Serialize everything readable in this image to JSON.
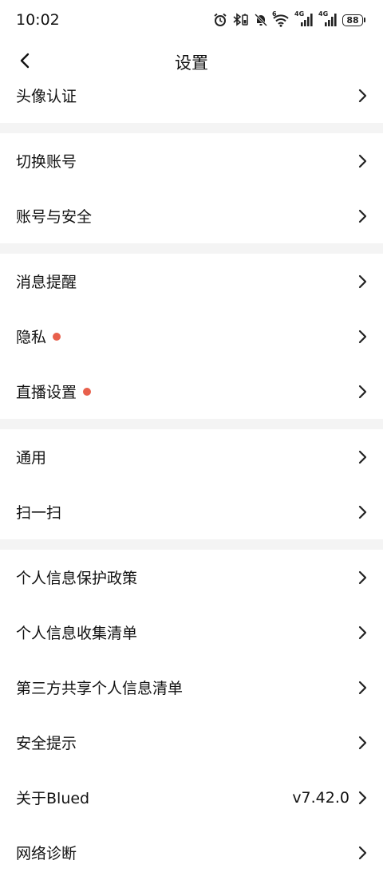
{
  "status_bar": {
    "time": "10:02",
    "battery": "88",
    "network1": "4G",
    "network2": "4G",
    "wifi_badge": "6"
  },
  "nav": {
    "title": "设置"
  },
  "groups": [
    {
      "items": [
        {
          "label": "头像认证"
        }
      ]
    },
    {
      "items": [
        {
          "label": "切换账号"
        },
        {
          "label": "账号与安全"
        }
      ]
    },
    {
      "items": [
        {
          "label": "消息提醒"
        },
        {
          "label": "隐私",
          "dot": true
        },
        {
          "label": "直播设置",
          "dot": true
        }
      ]
    },
    {
      "items": [
        {
          "label": "通用"
        },
        {
          "label": "扫一扫"
        }
      ]
    },
    {
      "items": [
        {
          "label": "个人信息保护政策"
        },
        {
          "label": "个人信息收集清单"
        },
        {
          "label": "第三方共享个人信息清单"
        },
        {
          "label": "安全提示"
        },
        {
          "label": "关于Blued",
          "value": "v7.42.0"
        },
        {
          "label": "网络诊断"
        }
      ]
    }
  ],
  "colors": {
    "dot": "#e8604c",
    "divider": "#f4f4f4"
  }
}
